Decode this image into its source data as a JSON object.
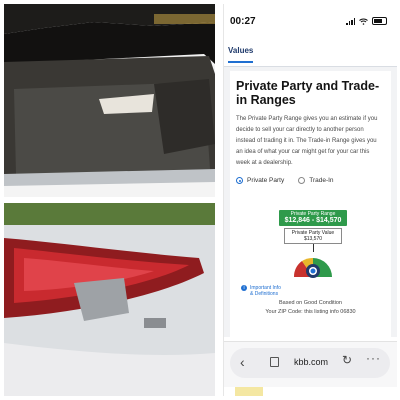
{
  "status_bar": {
    "time": "00:27",
    "icons": [
      "mute-bell-icon",
      "signal-icon",
      "wifi-icon",
      "battery-icon"
    ]
  },
  "tabs": {
    "active": "Values"
  },
  "card": {
    "title": "Private Party and Trade-in Ranges",
    "description": "The Private Party Range gives you an estimate if you decide to sell your car directly to another person instead of trading it in. The Trade-in Range gives you an idea of what your car might get for your car this week at a dealership.",
    "radio_options": [
      {
        "label": "Private Party",
        "selected": true
      },
      {
        "label": "Trade-In",
        "selected": false
      }
    ],
    "range_box": {
      "label": "Private Party Range",
      "value": "$12,846 - $14,570"
    },
    "ppv_box": {
      "label": "Private Party Value",
      "value": "$13,570"
    },
    "gauge_colors": [
      "#c8322e",
      "#e8b62b",
      "#2f9a4b"
    ],
    "info_link": "Important Info & Definitions",
    "condition_text": "Based on Good Condition",
    "zip_text": "Your ZIP Code: this listing info 06830"
  },
  "browser": {
    "url": "kbb.com",
    "back_icon": "chevron-left-icon",
    "tabs_icon": "tabs-icon",
    "reload_icon": "reload-icon",
    "more_icon": "more-icon"
  },
  "colors": {
    "accent": "#1f6fd1",
    "range_green": "#2f9a4b",
    "title_dark": "#141414"
  }
}
